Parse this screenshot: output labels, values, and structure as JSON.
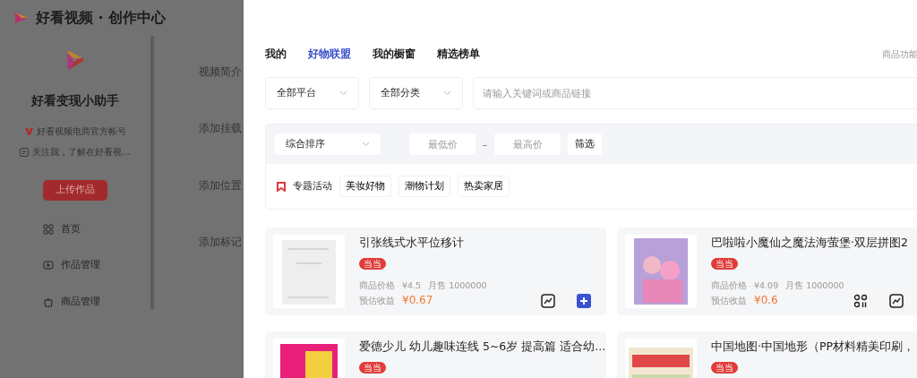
{
  "app": {
    "title": "好看视频 · 创作中心"
  },
  "profile": {
    "name": "好看变现小助手",
    "verified": "好看视频电商官方帐号",
    "intro": "关注我，了解在好看视..."
  },
  "upload_button": "上传作品",
  "nav": [
    {
      "label": "首页"
    },
    {
      "label": "作品管理"
    },
    {
      "label": "商品管理"
    }
  ],
  "form_labels": [
    "视频简介",
    "添加挂载",
    "添加位置",
    "添加标记"
  ],
  "drawer": {
    "tabs": [
      {
        "label": "我的",
        "selected": false
      },
      {
        "label": "好物联盟",
        "selected": true
      },
      {
        "label": "我的橱窗",
        "selected": false
      },
      {
        "label": "精选榜单",
        "selected": false
      }
    ],
    "help_link": "商品功能",
    "platform_select": "全部平台",
    "category_select": "全部分类",
    "search": {
      "placeholder": "请输入关键词或商品链接"
    },
    "sort_select": "综合排序",
    "min_price": {
      "placeholder": "最低价"
    },
    "price_separator": "–",
    "max_price": {
      "placeholder": "最高价"
    },
    "filter_button": "筛选",
    "topic_label": "专题活动",
    "topic_tags": [
      "美妆好物",
      "潮物计划",
      "热卖家居"
    ],
    "products": [
      {
        "title": "引张线式水平位移计",
        "badge": "当当",
        "price_label": "商品价格",
        "price": "¥4.5",
        "sales": "月售 1000000",
        "earning_label": "预估收益",
        "earning": "¥0.67"
      },
      {
        "title": "巴啦啦小魔仙之魔法海萤堡·双层拼图2",
        "badge": "当当",
        "price_label": "商品价格",
        "price": "¥4.09",
        "sales": "月售 1000000",
        "earning_label": "预估收益",
        "earning": "¥0.6"
      },
      {
        "title": "爱德少儿 幼儿趣味连线 5~6岁 提高篇 适合幼...",
        "badge": "当当"
      },
      {
        "title": "中国地图·中国地形（PP材料精美印刷，",
        "badge": "当当"
      }
    ]
  }
}
